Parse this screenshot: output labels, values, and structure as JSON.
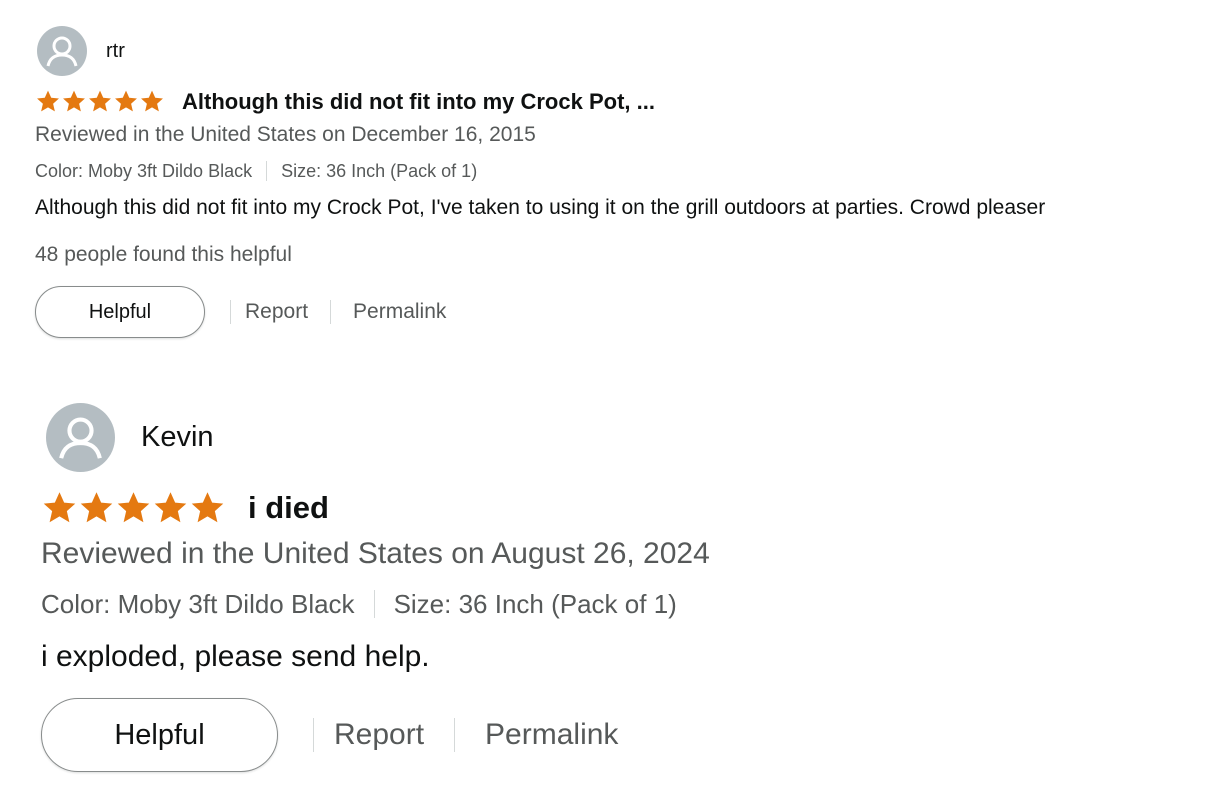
{
  "accent": {
    "star": "#e47911",
    "muted_text": "#565959",
    "avatar_bg": "#b4bdc2"
  },
  "reviews": [
    {
      "author": "rtr",
      "avatar_icon": "default-user-icon",
      "rating": 5,
      "title": "Although this did not fit into my Crock Pot, ...",
      "date": "Reviewed in the United States on December 16, 2015",
      "color": "Color: Moby 3ft Dildo Black",
      "size": "Size: 36 Inch (Pack of 1)",
      "body": "Although this did not fit into my Crock Pot, I've taken to using it on the grill outdoors at parties. Crowd pleaser",
      "helpful_count": "48 people found this helpful",
      "helpful_label": "Helpful",
      "report_label": "Report",
      "permalink_label": "Permalink"
    },
    {
      "author": "Kevin",
      "avatar_icon": "default-user-icon",
      "rating": 5,
      "title": "i died",
      "date": "Reviewed in the United States on August 26, 2024",
      "color": "Color: Moby 3ft Dildo Black",
      "size": "Size: 36 Inch (Pack of 1)",
      "body": "i exploded, please send help.",
      "helpful_label": "Helpful",
      "report_label": "Report",
      "permalink_label": "Permalink"
    }
  ]
}
